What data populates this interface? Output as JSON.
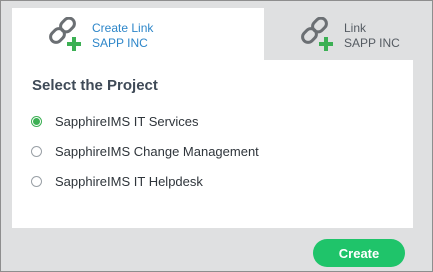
{
  "tabs": [
    {
      "line1": "Create Link",
      "line2": "SAPP INC",
      "icon": "link-add-icon",
      "active": true
    },
    {
      "line1": "Link",
      "line2": "SAPP INC",
      "icon": "link-add-icon",
      "active": false
    }
  ],
  "panel": {
    "title": "Select the Project",
    "options": [
      {
        "label": "SapphireIMS IT Services",
        "selected": true
      },
      {
        "label": "SapphireIMS Change Management",
        "selected": false
      },
      {
        "label": "SapphireIMS IT Helpdesk",
        "selected": false
      }
    ]
  },
  "footer": {
    "create_label": "Create"
  },
  "colors": {
    "accent_green": "#1fc46a",
    "radio_green": "#3cb054",
    "active_tab_text": "#2d86c9",
    "inactive_tab_text": "#555b62",
    "background": "#dfe0e1"
  }
}
